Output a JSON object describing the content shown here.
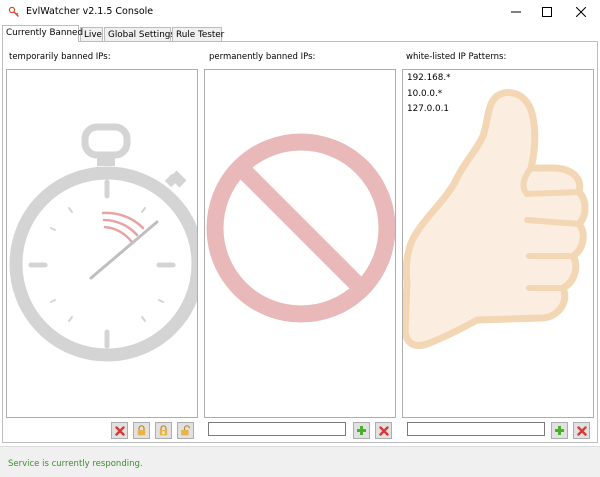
{
  "window": {
    "title": "EvlWatcher v2.1.5 Console"
  },
  "tabs": [
    {
      "label": "Currently Banned",
      "active": true
    },
    {
      "label": "Live",
      "active": false
    },
    {
      "label": "Global Settings",
      "active": false
    },
    {
      "label": "Rule Tester",
      "active": false
    }
  ],
  "panels": {
    "temporary": {
      "label": "temporarily banned IPs:",
      "items": [],
      "background_icon": "stopwatch-icon"
    },
    "permanent": {
      "label": "permanently banned IPs:",
      "items": [],
      "input_value": "",
      "background_icon": "prohibited-icon"
    },
    "whitelist": {
      "label": "white-listed IP Patterns:",
      "items": [
        "192.168.*",
        "10.0.0.*",
        "127.0.0.1"
      ],
      "input_value": "",
      "background_icon": "thumbs-up-icon"
    }
  },
  "toolbar_icons": {
    "temporary": [
      "delete-icon",
      "lock-icon",
      "lock-icon",
      "unlock-icon"
    ],
    "permanent": [
      "add-icon",
      "delete-icon"
    ],
    "whitelist": [
      "add-icon",
      "delete-icon"
    ]
  },
  "status": {
    "text": "Service is currently responding.",
    "color": "#3d8b2f"
  },
  "colors": {
    "delete": "#d83a3a",
    "add": "#4caf2e",
    "lock": "#e8b44a",
    "stopwatch": "#d4d4d4",
    "prohibited": "#e9b8b8",
    "thumb_fill": "#fbeee0",
    "thumb_stroke": "#f3d6b4"
  }
}
